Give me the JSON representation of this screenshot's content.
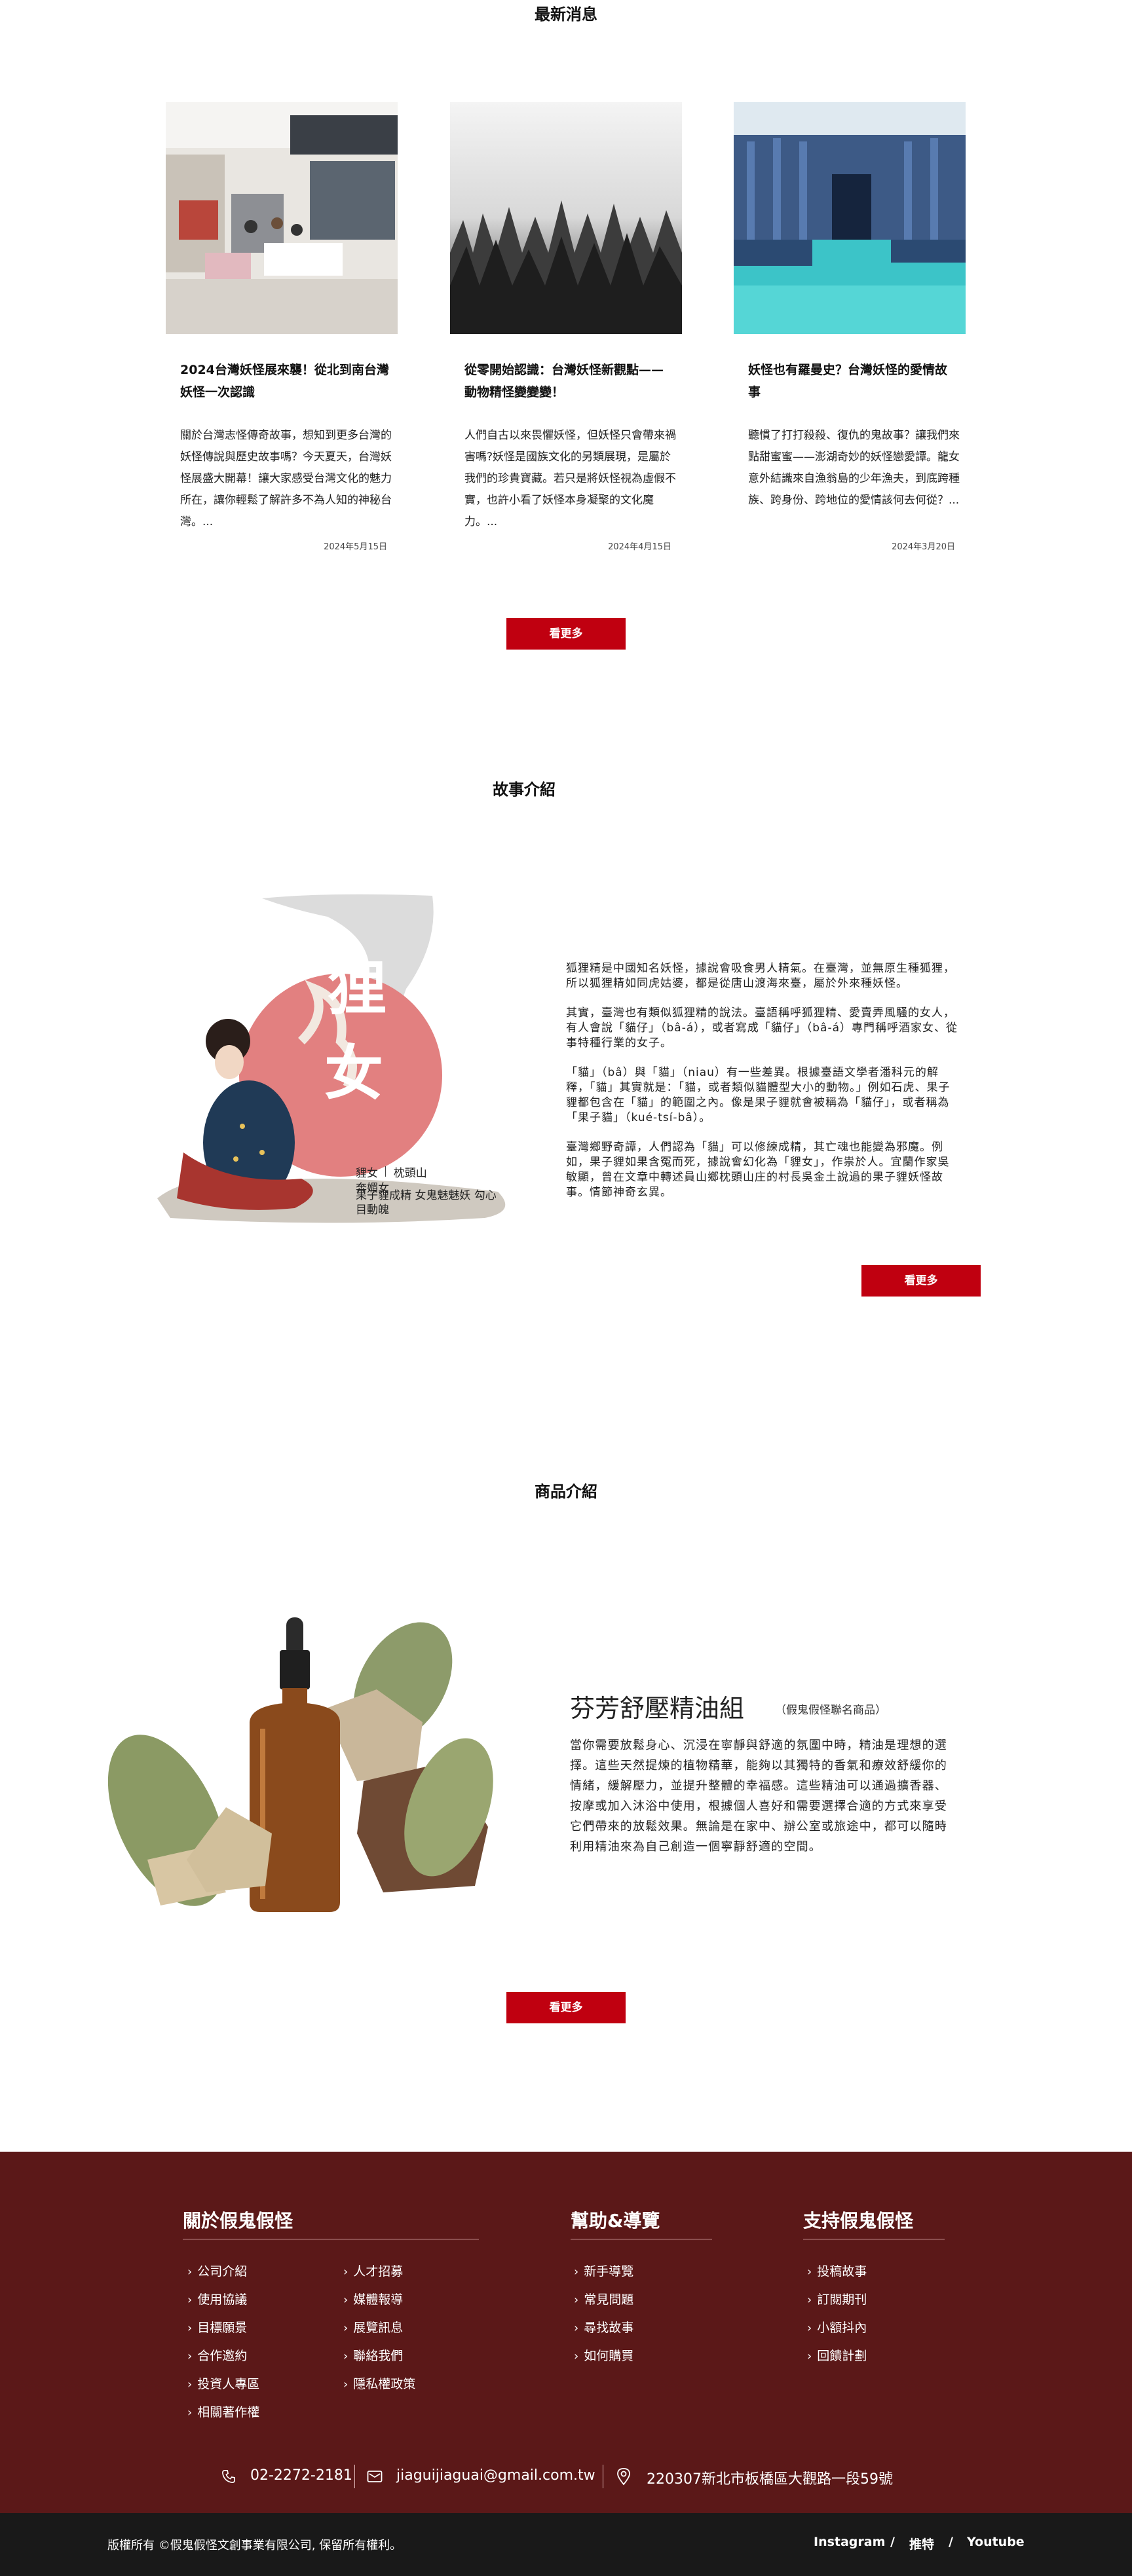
{
  "news": {
    "title": "最新消息",
    "cards": [
      {
        "title": "2024台灣妖怪展來襲！從北到南台灣妖怪一次認識",
        "desc": "關於台灣志怪傳奇故事，想知到更多台灣的妖怪傳說與歷史故事嗎？今天夏天，台灣妖怪展盛大開幕！讓大家感受台灣文化的魅力所在，讓你輕鬆了解許多不為人知的神秘台灣。...",
        "date": "2024年5月15日"
      },
      {
        "title": "從零開始認識：台灣妖怪新觀點——動物精怪變變變！",
        "desc": "人們自古以來畏懼妖怪，但妖怪只會帶來禍害嗎?妖怪是國族文化的另類展現，是屬於我們的珍貴寶藏。若只是將妖怪視為虛假不實，也許小看了妖怪本身凝聚的文化魔力。...",
        "date": "2024年4月15日"
      },
      {
        "title": "妖怪也有羅曼史？台灣妖怪的愛情故事",
        "desc": "聽慣了打打殺殺、復仇的鬼故事？讓我們來點甜蜜蜜——澎湖奇妙的妖怪戀愛譚。龍女意外結識來自漁翁島的少年漁夫，到底跨種族、跨身份、跨地位的愛情該何去何從？...",
        "date": "2024年3月20日"
      }
    ],
    "more": "看更多"
  },
  "story": {
    "title": "故事介紹",
    "art_glyphs": [
      "狸",
      "女"
    ],
    "tag_line1_a": "貍女",
    "tag_line1_b": "枕頭山",
    "tag_line2": "奔媚女",
    "tag_line3": "果子貍成精 女鬼魅魅妖 勾心",
    "tag_line4": "目動魄",
    "paragraphs": [
      "狐狸精是中國知名妖怪，據說會吸食男人精氣。在臺灣，並無原生種狐狸，所以狐狸精如同虎姑婆，都是從唐山渡海來臺，屬於外來種妖怪。",
      "其實，臺灣也有類似狐狸精的說法。臺語稱呼狐狸精、愛賣弄風騷的女人，有人會說「貓仔」（bâ-á），或者寫成「貓仔」（bâ-á）專門稱呼酒家女、從事特種行業的女子。",
      "「貓」（bâ）與「貓」（niau）有一些差異。根據臺語文學者潘科元的解釋，「貓」其實就是：「貓，或者類似貓體型大小的動物。」例如石虎、果子貍都包含在「貓」的範圍之內。像是果子貍就會被稱為「貓仔」，或者稱為「果子貓」（kué-tsí-bâ）。",
      "臺灣鄉野奇譚，人們認為「貓」可以修練成精，其亡魂也能變為邪魔。例如，果子貍如果含冤而死，據說會幻化為「貍女」，作祟於人。宜蘭作家吳敏顯，曾在文章中轉述員山鄉枕頭山庄的村長吳金土說過的果子貍妖怪故事。情節神奇玄異。"
    ],
    "more": "看更多"
  },
  "product": {
    "title": "商品介紹",
    "name": "芬芳舒壓精油組",
    "sub": "（假鬼假怪聯名商品）",
    "desc": "當你需要放鬆身心、沉浸在寧靜與舒適的氛圍中時，精油是理想的選擇。這些天然提煉的植物精華，能夠以其獨特的香氣和療效舒緩你的情緒，緩解壓力，並提升整體的幸福感。這些精油可以通過擴香器、按摩或加入沐浴中使用，根據個人喜好和需要選擇合適的方式來享受它們帶來的放鬆效果。無論是在家中、辦公室或旅途中，都可以隨時利用精油來為自己創造一個寧靜舒適的空間。",
    "more": "看更多"
  },
  "footer": {
    "about": {
      "heading": "關於假鬼假怪",
      "col1": [
        "公司介紹",
        "使用協議",
        "目標願景",
        "合作邀約",
        "投資人專區",
        "相關著作權"
      ],
      "col2": [
        "人才招募",
        "媒體報導",
        "展覽訊息",
        "聯絡我們",
        "隱私權政策"
      ]
    },
    "help": {
      "heading": "幫助&導覽",
      "items": [
        "新手導覽",
        "常見問題",
        "尋找故事",
        "如何購買"
      ]
    },
    "support": {
      "heading": "支持假鬼假怪",
      "items": [
        "投稿故事",
        "訂閱期刊",
        "小額抖內",
        "回饋計劃"
      ]
    },
    "contact": {
      "phone": "02-2272-2181",
      "email": "jiaguijiaguai@gmail.com.tw",
      "address": "220307新北市板橋區大觀路一段59號"
    },
    "copyright": "版權所有 ©假鬼假怪文創事業有限公司, 保留所有權利。",
    "social": [
      "Instagram",
      "推特",
      "Youtube"
    ],
    "social_sep": "/"
  },
  "colors": {
    "accent": "#c00010",
    "footer_bg": "#5b1818",
    "bottom_bg": "#191919"
  }
}
